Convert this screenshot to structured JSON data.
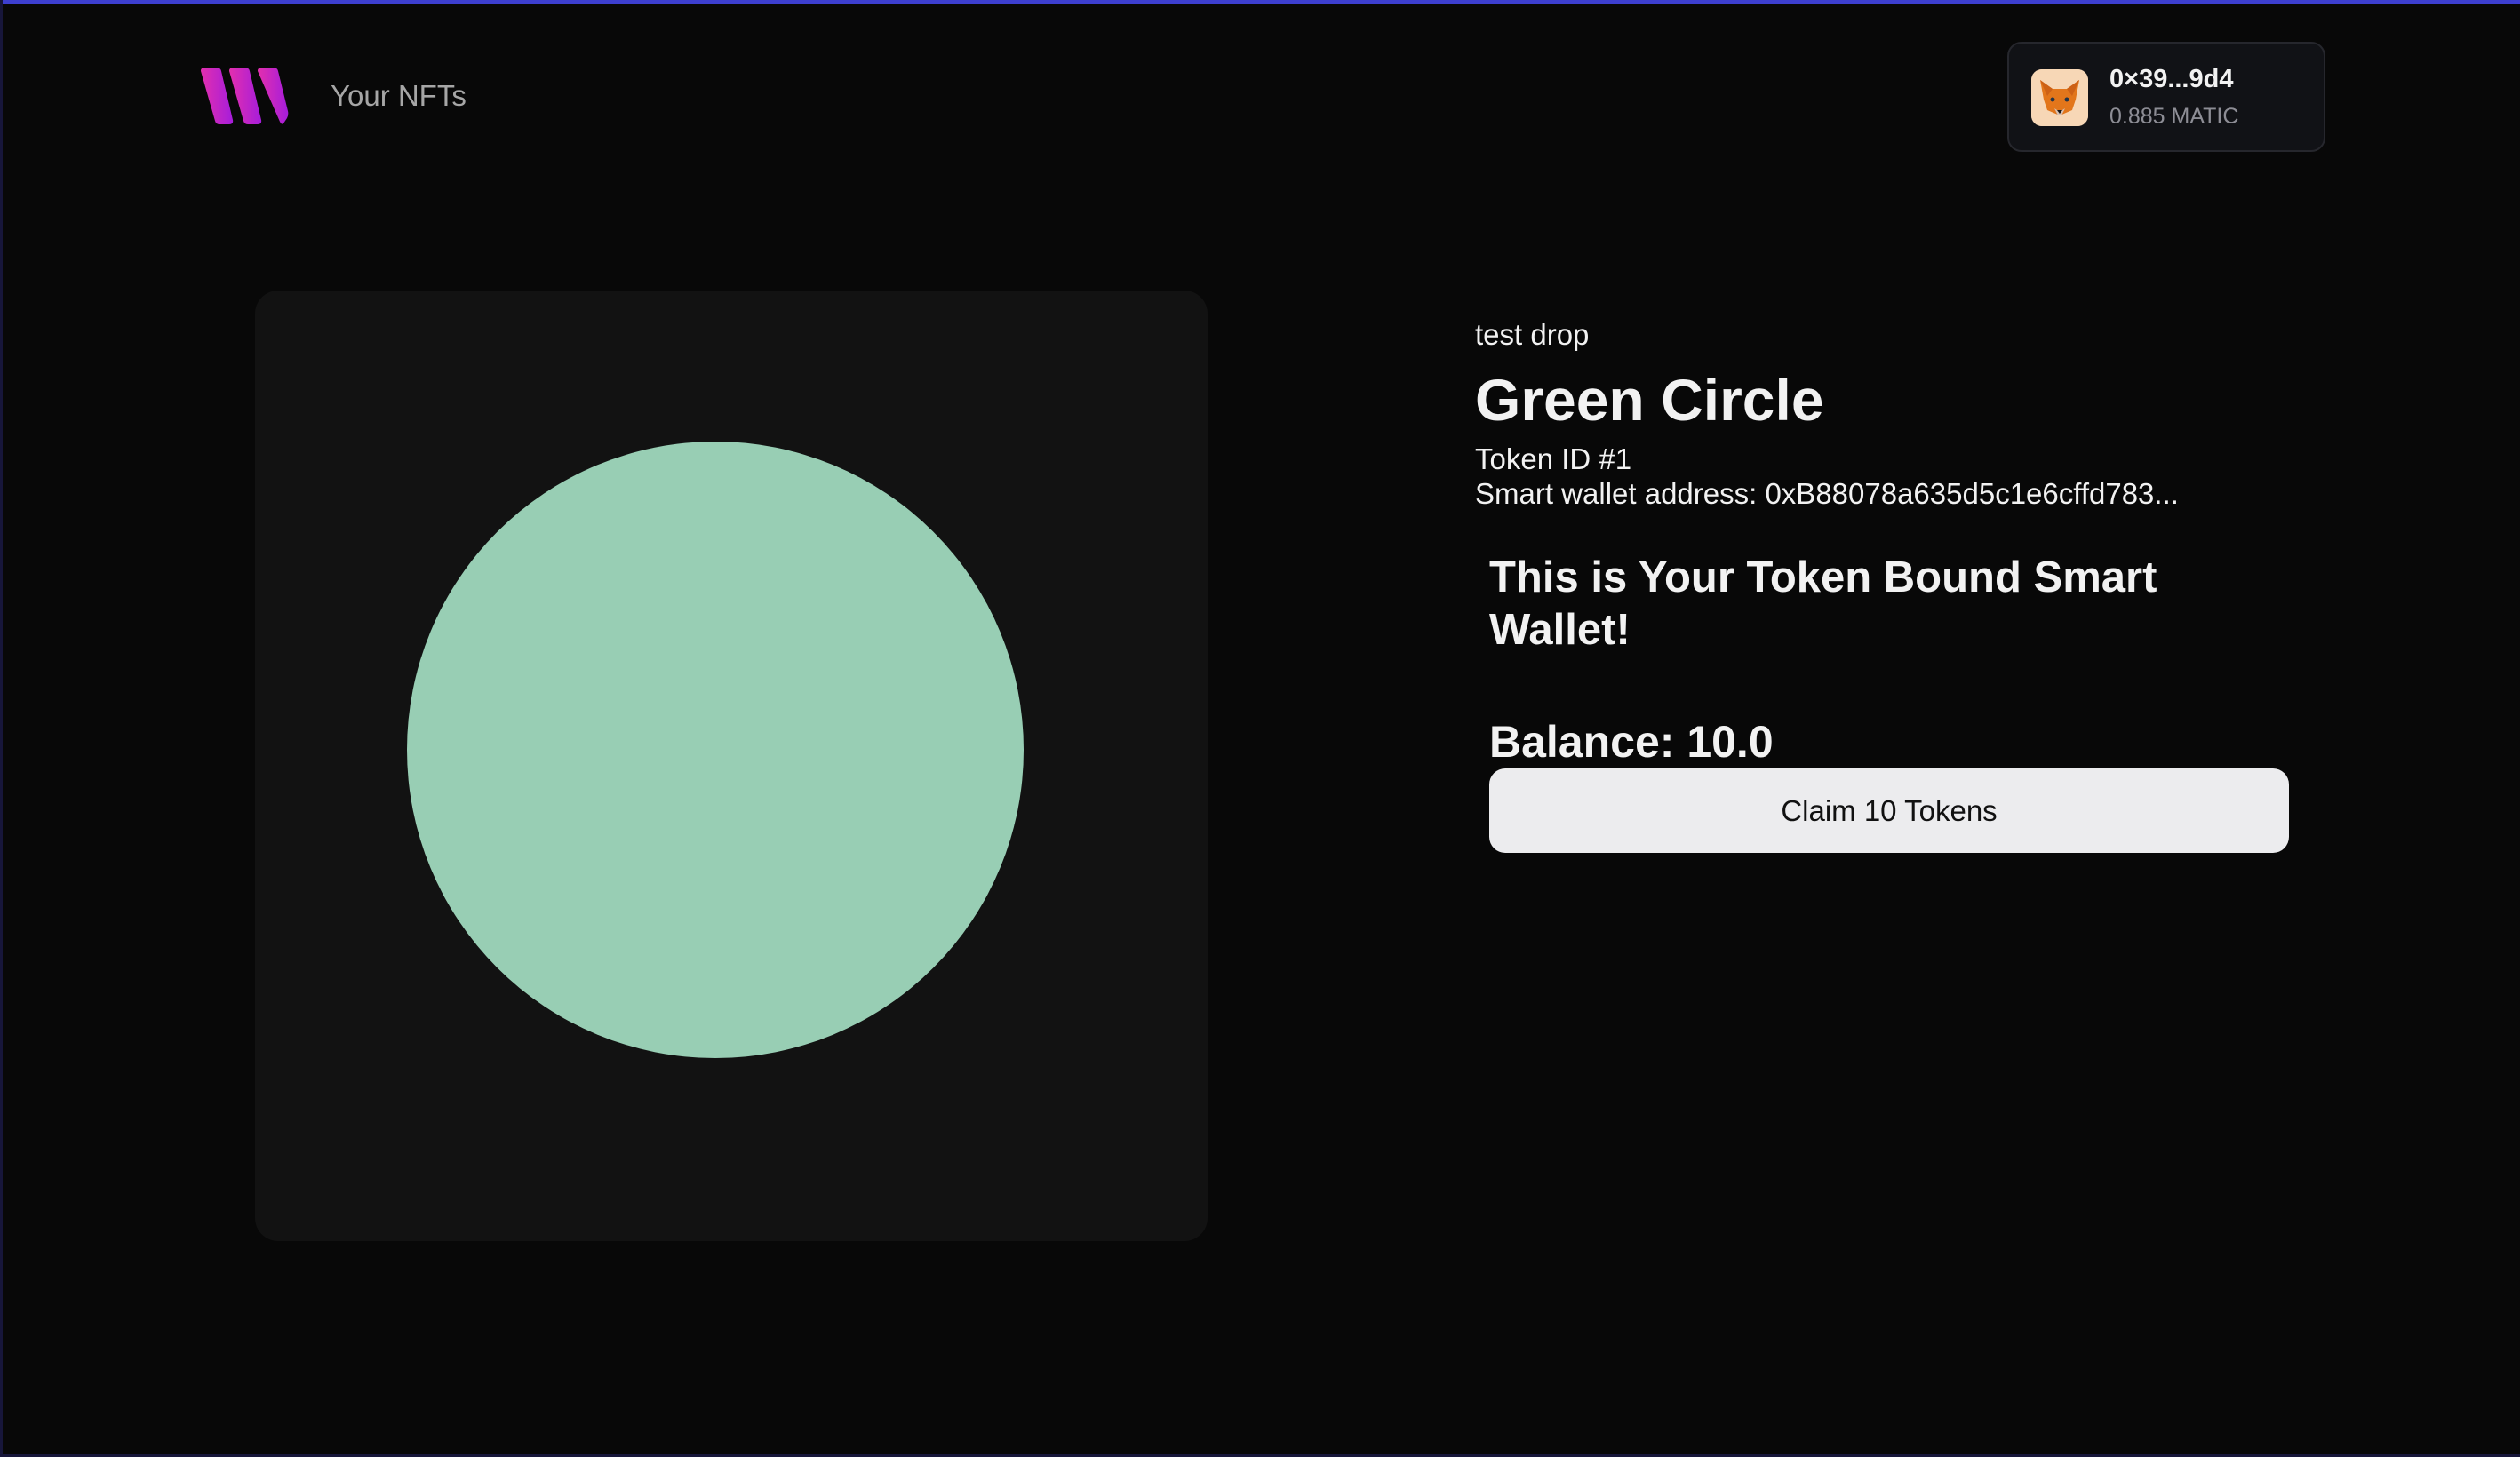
{
  "header": {
    "nav_link": "Your NFTs",
    "logo_icon": "brand-logo-icon",
    "brand_colors": [
      "#e32fae",
      "#a51ddb"
    ]
  },
  "wallet": {
    "address": "0×39...9d4",
    "balance": "0.885 MATIC",
    "avatar_icon": "metamask-fox-icon"
  },
  "nft": {
    "image_color": "#98ceb4",
    "collection": "test drop",
    "name": "Green Circle",
    "token_id": "Token ID #1",
    "smart_wallet_address": "Smart wallet address: 0xB88078a635d5c1e6cffd783..."
  },
  "smart_wallet": {
    "heading": "This is Your Token Bound Smart Wallet!",
    "balance": "Balance: 10.0",
    "claim_button_label": "Claim 10 Tokens"
  },
  "colors": {
    "background": "#080808",
    "accent": "#3d3fd0",
    "card": "#121212",
    "button": "#ececee"
  }
}
